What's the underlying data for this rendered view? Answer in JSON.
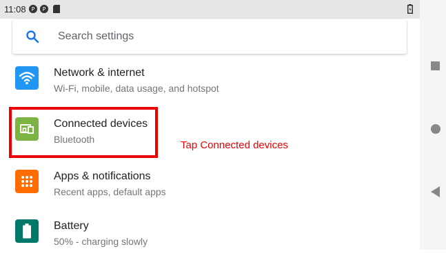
{
  "status_bar": {
    "time": "11:08",
    "icons": [
      "notification-p-icon",
      "notification-p-icon",
      "sd-card-icon",
      "battery-icon"
    ]
  },
  "search": {
    "placeholder": "Search settings",
    "icon": "search-icon"
  },
  "settings_items": [
    {
      "title": "Network & internet",
      "subtitle": "Wi-Fi, mobile, data usage, and hotspot",
      "icon": "wifi-icon",
      "color": "#2196f3"
    },
    {
      "title": "Connected devices",
      "subtitle": "Bluetooth",
      "icon": "connected-devices-icon",
      "color": "#7cb342"
    },
    {
      "title": "Apps & notifications",
      "subtitle": "Recent apps, default apps",
      "icon": "apps-grid-icon",
      "color": "#ff6d00"
    },
    {
      "title": "Battery",
      "subtitle": "50% - charging slowly",
      "icon": "battery-icon",
      "color": "#00796b"
    }
  ],
  "annotation": {
    "text": "Tap Connected devices",
    "color": "#ee0000"
  },
  "nav_bar": {
    "buttons": [
      "recents-square-icon",
      "home-circle-icon",
      "back-triangle-icon"
    ]
  }
}
